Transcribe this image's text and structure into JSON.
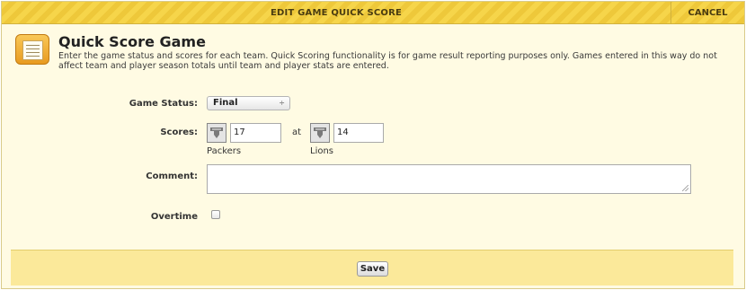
{
  "dialog": {
    "title": "EDIT GAME QUICK SCORE",
    "cancel_label": "CANCEL"
  },
  "header": {
    "icon": "scoresheet-icon",
    "heading": "Quick Score Game",
    "description": "Enter the game status and scores for each team. Quick Scoring functionality is for game result reporting purposes only. Games entered in this way do not affect team and player season totals until team and player stats are entered."
  },
  "form": {
    "game_status": {
      "label": "Game Status:",
      "selected": "Final",
      "arrows": "÷"
    },
    "scores": {
      "label": "Scores:",
      "separator": "at",
      "home": {
        "team": "Packers",
        "score": "17",
        "icon": "team-logo-icon"
      },
      "away": {
        "team": "Lions",
        "score": "14",
        "icon": "team-logo-icon"
      }
    },
    "comment": {
      "label": "Comment:",
      "value": ""
    },
    "overtime": {
      "label": "Overtime",
      "checked": false
    }
  },
  "footer": {
    "save_label": "Save"
  },
  "colors": {
    "titlebar": "#f6d54a",
    "panel": "#fffbe3",
    "footer": "#fbe99a"
  }
}
